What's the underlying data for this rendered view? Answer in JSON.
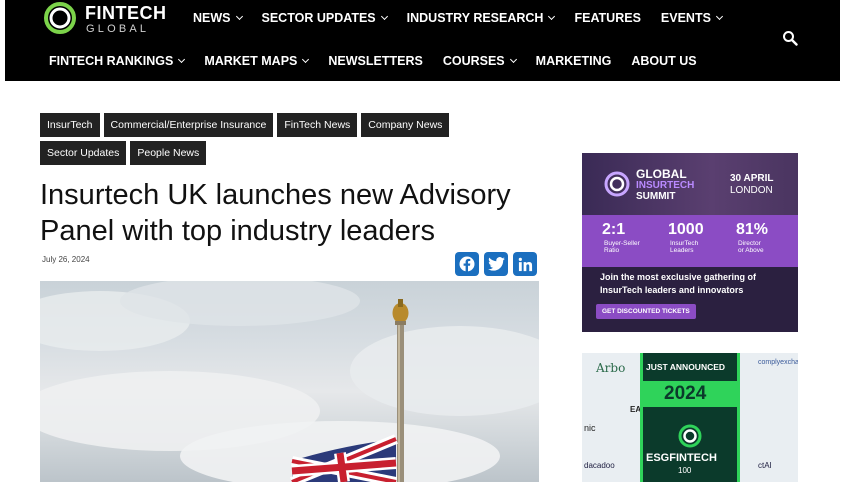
{
  "logo": {
    "line1": "FINTECH",
    "line2": "GLOBAL"
  },
  "nav_row1": [
    {
      "label": "NEWS",
      "dropdown": true
    },
    {
      "label": "SECTOR UPDATES",
      "dropdown": true
    },
    {
      "label": "INDUSTRY RESEARCH",
      "dropdown": true
    },
    {
      "label": "FEATURES",
      "dropdown": false
    },
    {
      "label": "EVENTS",
      "dropdown": true
    }
  ],
  "nav_row2": [
    {
      "label": "FINTECH RANKINGS",
      "dropdown": true
    },
    {
      "label": "MARKET MAPS",
      "dropdown": true
    },
    {
      "label": "NEWSLETTERS",
      "dropdown": false
    },
    {
      "label": "COURSES",
      "dropdown": true
    },
    {
      "label": "MARKETING",
      "dropdown": false
    },
    {
      "label": "ABOUT US",
      "dropdown": false
    }
  ],
  "tags": [
    "InsurTech",
    "Commercial/Enterprise Insurance",
    "FinTech News",
    "Company News",
    "Sector Updates",
    "People News"
  ],
  "article": {
    "title": "Insurtech UK launches new Advisory Panel with top industry leaders",
    "date": "July 26, 2024"
  },
  "share": [
    "facebook-icon",
    "twitter-icon",
    "linkedin-icon"
  ],
  "ad1": {
    "brand_line1": "GLOBAL",
    "brand_line2": "INSURTECH",
    "brand_line3": "SUMMIT",
    "date_line1": "30 APRIL",
    "date_line2": "LONDON",
    "stats": [
      {
        "value": "2:1",
        "label1": "Buyer-Seller",
        "label2": "Ratio"
      },
      {
        "value": "1000",
        "label1": "InsurTech",
        "label2": "Leaders"
      },
      {
        "value": "81%",
        "label1": "Director",
        "label2": "or Above"
      }
    ],
    "tagline1": "Join the most exclusive gathering of",
    "tagline2": "InsurTech leaders and innovators",
    "cta": "GET DISCOUNTED TICKETS"
  },
  "ad2": {
    "announce": "JUST ANNOUNCED",
    "year": "2024",
    "brand": "ESGFINTECH",
    "number": "100",
    "tiles": [
      "Arbo",
      "complyexcha",
      "EA",
      "nic",
      "dacadoo",
      "ctAI"
    ]
  },
  "colors": {
    "header_bg": "#000000",
    "tag_bg": "#222222",
    "share_blue": "#1b6fbf",
    "ad1_purple": "#8b4cc4",
    "ad2_green": "#2fd35a"
  }
}
